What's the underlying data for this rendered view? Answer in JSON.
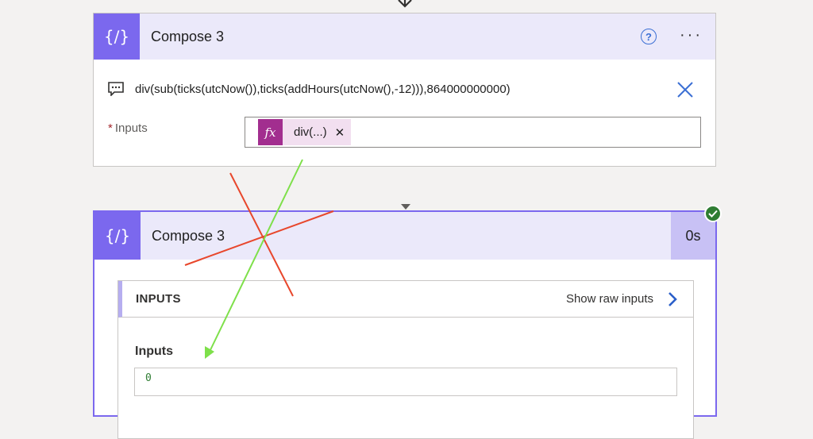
{
  "edit_card": {
    "title": "Compose 3",
    "icon_glyph": "{∕}",
    "expression": "div(sub(ticks(utcNow()),ticks(addHours(utcNow(),-12))),864000000000)",
    "required_mark": "*",
    "inputs_label": "Inputs",
    "token": {
      "fx": "fx",
      "label": "div(...)",
      "close": "✕"
    },
    "help_glyph": "?",
    "more_glyph": "···"
  },
  "run_card": {
    "title": "Compose 3",
    "icon_glyph": "{∕}",
    "duration": "0s",
    "status": "succeeded",
    "section_title": "INPUTS",
    "show_raw_label": "Show raw inputs",
    "field_label": "Inputs",
    "field_value": "0"
  },
  "colors": {
    "accent": "#7b68ee",
    "header_bg": "#ebe9fa",
    "token": "#a22e8f",
    "success": "#2f7d33",
    "annotation_red": "#e8472c",
    "annotation_green": "#7ee04a",
    "link_blue": "#3b6fd4"
  },
  "icons": [
    "down-arrow-icon",
    "compose-icon",
    "help-icon",
    "more-options-icon",
    "comment-icon",
    "close-icon",
    "fx-icon",
    "checkmark-icon",
    "chevron-right-icon"
  ]
}
